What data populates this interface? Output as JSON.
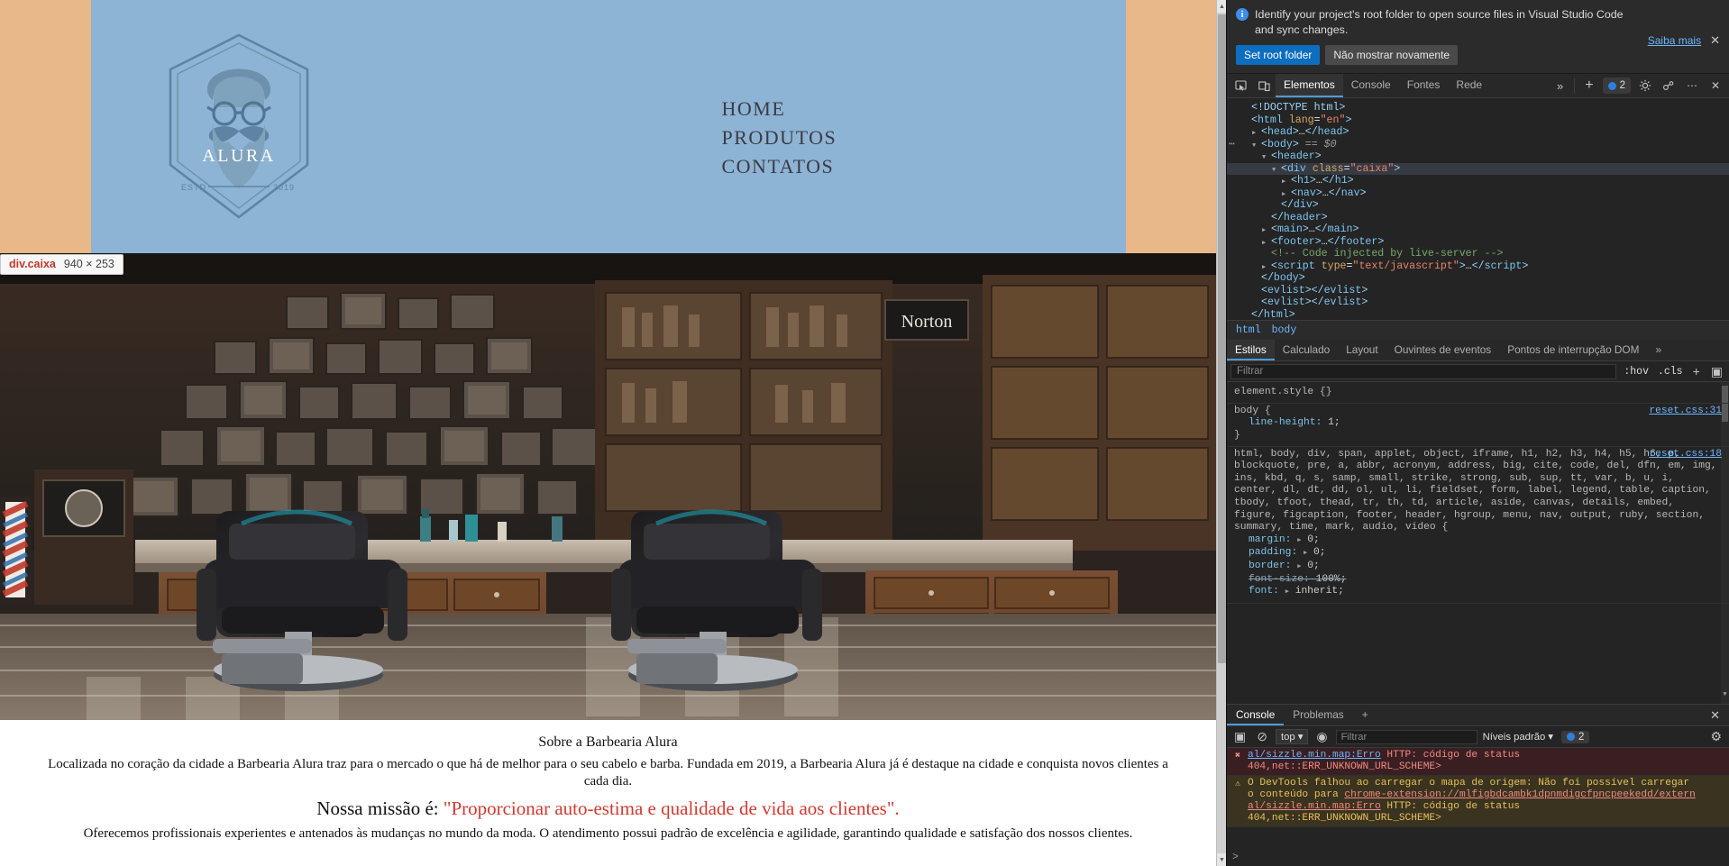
{
  "webpage": {
    "logo": {
      "brand": "ALURA",
      "estd": "ESTD",
      "year": "2019"
    },
    "nav": [
      "HOME",
      "PRODUTOS",
      "CONTATOS"
    ],
    "inspect_tooltip": {
      "selector": "div.caixa",
      "dimensions": "940 × 253"
    },
    "sobre": {
      "title": "Sobre a Barbearia Alura",
      "paragraph1": "Localizada no coração da cidade a Barbearia Alura traz para o mercado o que há de melhor para o seu cabelo e barba. Fundada em 2019, a Barbearia Alura já é destaque na cidade e conquista novos clientes a cada dia.",
      "mission_label": "Nossa missão é:",
      "mission_quote": "\"Proporcionar auto-estima e qualidade de vida aos clientes\".",
      "paragraph2": "Oferecemos profissionais experientes e antenados às mudanças no mundo da moda. O atendimento possui padrão de excelência e agilidade, garantindo qualidade e satisfação dos nossos clientes."
    },
    "colors": {
      "header_band": "#e8b888",
      "caixa": "#8db4d4",
      "accent_red": "#d2392f"
    }
  },
  "devtools": {
    "notice": {
      "text": "Identify your project's root folder to open source files in Visual Studio Code and sync changes.",
      "primary_button": "Set root folder",
      "secondary_button": "Não mostrar novamente",
      "learn_more": "Saiba mais",
      "close": "✕"
    },
    "toolbar": {
      "tabs": [
        "Elementos",
        "Console",
        "Fontes",
        "Rede"
      ],
      "active_tab": "Elementos",
      "more_tabs": "»",
      "plus": "+",
      "error_count": "2",
      "settings": "gear-icon",
      "customize": "⋯",
      "close": "✕"
    },
    "dom_tree": [
      {
        "indent": 1,
        "arrow": "none",
        "html": "<span class=\"punct\">&lt;!DOCTYPE html&gt;</span>",
        "selected": false
      },
      {
        "indent": 1,
        "arrow": "none",
        "html": "<span class=\"punct\">&lt;</span><span class=\"tag\">html</span> <span class=\"attr-name\">lang</span>=<span class=\"attr-val\">\"en\"</span><span class=\"punct\">&gt;</span>",
        "selected": false
      },
      {
        "indent": 2,
        "arrow": "closed",
        "html": "<span class=\"punct\">&lt;</span><span class=\"tag\">head</span><span class=\"punct\">&gt;</span>…<span class=\"punct\">&lt;/</span><span class=\"tag\">head</span><span class=\"punct\">&gt;</span>",
        "selected": false
      },
      {
        "indent": 2,
        "arrow": "open",
        "html": "<span class=\"punct\">&lt;</span><span class=\"tag\">body</span><span class=\"punct\">&gt;</span> <span class=\"eq\">==</span> <span class=\"dollar\">$0</span>",
        "selected": false,
        "dots": true
      },
      {
        "indent": 3,
        "arrow": "open",
        "html": "<span class=\"punct\">&lt;</span><span class=\"tag\">header</span><span class=\"punct\">&gt;</span>",
        "selected": false
      },
      {
        "indent": 4,
        "arrow": "open",
        "html": "<span class=\"punct\">&lt;</span><span class=\"tag\">div</span> <span class=\"attr-name\">class</span>=<span class=\"attr-val\">\"caixa\"</span><span class=\"punct\">&gt;</span>",
        "selected": true
      },
      {
        "indent": 5,
        "arrow": "closed",
        "html": "<span class=\"punct\">&lt;</span><span class=\"tag\">h1</span><span class=\"punct\">&gt;</span>…<span class=\"punct\">&lt;/</span><span class=\"tag\">h1</span><span class=\"punct\">&gt;</span>",
        "selected": false
      },
      {
        "indent": 5,
        "arrow": "closed",
        "html": "<span class=\"punct\">&lt;</span><span class=\"tag\">nav</span><span class=\"punct\">&gt;</span>…<span class=\"punct\">&lt;/</span><span class=\"tag\">nav</span><span class=\"punct\">&gt;</span>",
        "selected": false
      },
      {
        "indent": 4,
        "arrow": "none",
        "html": "<span class=\"punct\">&lt;/</span><span class=\"tag\">div</span><span class=\"punct\">&gt;</span>",
        "selected": false
      },
      {
        "indent": 3,
        "arrow": "none",
        "html": "<span class=\"punct\">&lt;/</span><span class=\"tag\">header</span><span class=\"punct\">&gt;</span>",
        "selected": false
      },
      {
        "indent": 3,
        "arrow": "closed",
        "html": "<span class=\"punct\">&lt;</span><span class=\"tag\">main</span><span class=\"punct\">&gt;</span>…<span class=\"punct\">&lt;/</span><span class=\"tag\">main</span><span class=\"punct\">&gt;</span>",
        "selected": false
      },
      {
        "indent": 3,
        "arrow": "closed",
        "html": "<span class=\"punct\">&lt;</span><span class=\"tag\">footer</span><span class=\"punct\">&gt;</span>…<span class=\"punct\">&lt;/</span><span class=\"tag\">footer</span><span class=\"punct\">&gt;</span>",
        "selected": false
      },
      {
        "indent": 3,
        "arrow": "none",
        "html": "<span class=\"comment\">&lt;!-- Code injected by live-server --&gt;</span>",
        "selected": false
      },
      {
        "indent": 3,
        "arrow": "closed",
        "html": "<span class=\"punct\">&lt;</span><span class=\"tag\">script</span> <span class=\"attr-name\">type</span>=<span class=\"attr-val\">\"text/javascript\"</span><span class=\"punct\">&gt;</span>…<span class=\"punct\">&lt;/</span><span class=\"tag\">script</span><span class=\"punct\">&gt;</span>",
        "selected": false
      },
      {
        "indent": 2,
        "arrow": "none",
        "html": "<span class=\"punct\">&lt;/</span><span class=\"tag\">body</span><span class=\"punct\">&gt;</span>",
        "selected": false
      },
      {
        "indent": 2,
        "arrow": "none",
        "html": "<span class=\"punct\">&lt;</span><span class=\"tag\">evlist</span><span class=\"punct\">&gt;&lt;/</span><span class=\"tag\">evlist</span><span class=\"punct\">&gt;</span>",
        "selected": false
      },
      {
        "indent": 2,
        "arrow": "none",
        "html": "<span class=\"punct\">&lt;</span><span class=\"tag\">evlist</span><span class=\"punct\">&gt;&lt;/</span><span class=\"tag\">evlist</span><span class=\"punct\">&gt;</span>",
        "selected": false
      },
      {
        "indent": 1,
        "arrow": "none",
        "html": "<span class=\"punct\">&lt;/</span><span class=\"tag\">html</span><span class=\"punct\">&gt;</span>",
        "selected": false
      }
    ],
    "breadcrumb": [
      "html",
      "body"
    ],
    "styles_tabs": [
      "Estilos",
      "Calculado",
      "Layout",
      "Ouvintes de eventos",
      "Pontos de interrupção DOM"
    ],
    "styles_active_tab": "Estilos",
    "styles_more": "»",
    "styles_filter_placeholder": "Filtrar",
    "styles_buttons": {
      "hov": ":hov",
      "cls": ".cls",
      "plus": "+",
      "panel": "▣"
    },
    "css_rules": [
      {
        "selector": "element.style {",
        "source": "",
        "props": [],
        "close": "}"
      },
      {
        "selector": "body {",
        "source": "reset.css:31",
        "props": [
          {
            "name": "line-height",
            "value": "1;",
            "struck": false,
            "tri": false
          }
        ],
        "close": "}"
      },
      {
        "selector": "html, body, div, span, applet, object, iframe, h1, h2, h3, h4, h5, h6, p, blockquote, pre, a, abbr, acronym, address, big, cite, code, del, dfn, em, img, ins, kbd, q, s, samp, small, strike, strong, sub, sup, tt, var, b, u, i, center, dl, dt, dd, ol, ul, li, fieldset, form, label, legend, table, caption, tbody, tfoot, thead, tr, th, td, article, aside, canvas, details, embed, figure, figcaption, footer, header, hgroup, menu, nav, output, ruby, section, summary, time, mark, audio, video {",
        "source": "reset.css:18",
        "props": [
          {
            "name": "margin",
            "value": "0;",
            "struck": false,
            "tri": true
          },
          {
            "name": "padding",
            "value": "0;",
            "struck": false,
            "tri": true
          },
          {
            "name": "border",
            "value": "0;",
            "struck": false,
            "tri": true
          },
          {
            "name": "font-size",
            "value": "100%;",
            "struck": true,
            "tri": false
          },
          {
            "name": "font",
            "value": "inherit;",
            "struck": false,
            "tri": true
          }
        ],
        "close": ""
      }
    ],
    "console": {
      "tabs": [
        "Console",
        "Problemas"
      ],
      "active_tab": "Console",
      "plus": "+",
      "close": "✕",
      "context": "top",
      "filter_placeholder": "Filtrar",
      "levels": "Níveis padrão",
      "error_count": "2",
      "messages": [
        {
          "type": "error",
          "line1_link": "al/sizzle.min.map:Erro",
          "line1_rest": " HTTP: código de status",
          "line2": "404,net::ERR_UNKNOWN_URL_SCHEME>"
        },
        {
          "type": "warning",
          "line1_rest": "O DevTools falhou ao carregar o mapa de origem: Não foi possível carregar",
          "line2_pre": "o conteúdo para ",
          "line2_link": "chrome-extension://mlfigbdcambk1dpnmdigcfpncpeekedd/extern",
          "line3_link": "al/sizzle.min.map:Erro",
          "line3_rest": " HTTP: código de status",
          "line4": "404,net::ERR_UNKNOWN_URL_SCHEME>"
        }
      ],
      "prompt": ">"
    }
  }
}
